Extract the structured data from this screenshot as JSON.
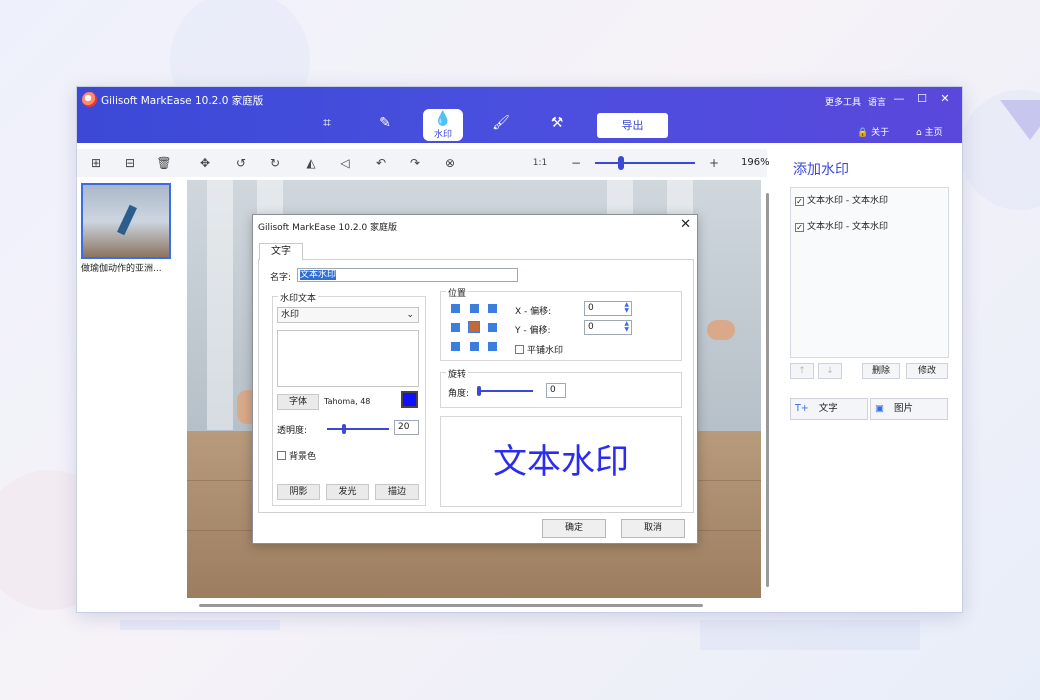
{
  "app": {
    "title": "Gilisoft MarkEase 10.2.0 家庭版",
    "more_tools": "更多工具",
    "language": "语言",
    "about": "关于",
    "home": "主页",
    "export": "导出",
    "active_tab_label": "水印",
    "brand_color": "#3b49d6"
  },
  "toolbar": {
    "zoom_ratio": "1:1",
    "zoom_percent": "196%",
    "zoom_level_fraction": 0.25
  },
  "thumbnails": [
    {
      "caption": "做瑜伽动作的亚洲..."
    }
  ],
  "right_panel": {
    "title": "添加水印",
    "items": [
      {
        "label": "文本水印 - 文本水印",
        "checked": true
      },
      {
        "label": "文本水印 - 文本水印",
        "checked": true
      }
    ],
    "delete": "删除",
    "modify": "修改",
    "add_text": "文字",
    "add_image": "图片"
  },
  "dialog": {
    "title": "Gilisoft MarkEase 10.2.0 家庭版",
    "tab": "文字",
    "name_label": "名字:",
    "name_value": "文本水印",
    "watermark_text_group": "水印文本",
    "combo_value": "水印",
    "font_button": "字体",
    "font_desc": "Tahoma, 48",
    "font_color": "#1010ff",
    "opacity_label": "透明度:",
    "opacity_value": "20",
    "background_label": "背景色",
    "shadow": "阴影",
    "glow": "发光",
    "stroke": "描边",
    "position_group": "位置",
    "x_offset_label": "X - 偏移:",
    "x_offset_value": "0",
    "y_offset_label": "Y - 偏移:",
    "y_offset_value": "0",
    "tile_label": "平铺水印",
    "rotation_group": "旋转",
    "angle_label": "角度:",
    "angle_value": "0",
    "preview_text": "文本水印",
    "ok": "确定",
    "cancel": "取消"
  }
}
